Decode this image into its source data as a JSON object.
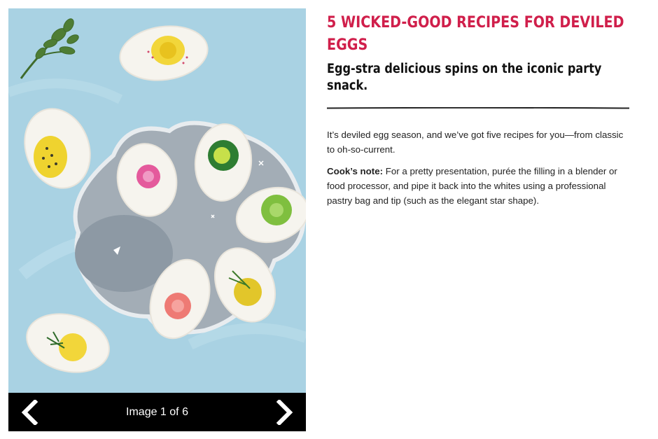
{
  "gallery": {
    "counter_text": "Image 1 of 6",
    "prev_icon": "chevron-left-icon",
    "next_icon": "chevron-right-icon",
    "background_color": "#a9d2e3",
    "bar_color": "#000000"
  },
  "article": {
    "title": "5 WICKED-GOOD RECIPES FOR DEVILED EGGS",
    "subtitle": "Egg-stra delicious spins on the iconic party snack.",
    "intro": "It’s deviled egg season, and we’ve got five recipes for you—from classic to oh-so-current.",
    "note_label": "Cook’s note:",
    "note_text": " For a pretty presentation, purée the filling in a blender or food processor, and pipe it back into the whites using a professional pastry bag and tip (such as the elegant star shape).",
    "title_color": "#d01f4b"
  }
}
